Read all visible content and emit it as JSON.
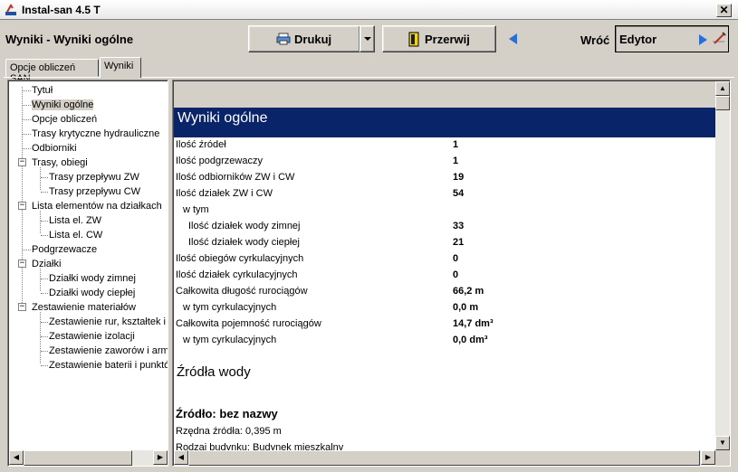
{
  "window": {
    "title": "Instal-san 4.5 T",
    "close": "✕"
  },
  "header": {
    "heading": "Wyniki - Wyniki ogólne",
    "print_label": "Drukuj",
    "break_label": "Przerwij",
    "back_label": "Wróć",
    "editor_label": "Edytor"
  },
  "tabs": [
    {
      "label": "Opcje obliczeń SAN"
    },
    {
      "label": "Wyniki"
    }
  ],
  "tree": {
    "items": [
      "Tytuł",
      "Wyniki ogólne",
      "Opcje obliczeń",
      "Trasy krytyczne hydrauliczne",
      "Odbiorniki",
      "Trasy, obiegi",
      "Trasy przepływu ZW",
      "Trasy przepływu CW",
      "Lista elementów na działkach",
      "Lista el. ZW",
      "Lista el. CW",
      "Podgrzewacze",
      "Działki",
      "Działki wody zimnej",
      "Działki wody ciepłej",
      "Zestawienie materiałów",
      "Zestawienie rur, kształtek i",
      "Zestawienie izolacji",
      "Zestawienie zaworów i armat",
      "Zestawienie baterii i punktów"
    ],
    "expander_minus": "−"
  },
  "content": {
    "banner": "Wyniki ogólne",
    "rows": [
      {
        "label": "Ilość źródeł",
        "value": "1"
      },
      {
        "label": "Ilość podgrzewaczy",
        "value": "1"
      },
      {
        "label": "Ilość odbiorników ZW i CW",
        "value": "19"
      },
      {
        "label": "Ilość działek ZW i CW",
        "value": "54"
      },
      {
        "label": "w tym",
        "value": ""
      },
      {
        "label": "Ilość działek wody zimnej",
        "value": "33"
      },
      {
        "label": "Ilość działek wody ciepłej",
        "value": "21"
      },
      {
        "label": "Ilość obiegów cyrkulacyjnych",
        "value": "0"
      },
      {
        "label": "Ilość działek cyrkulacyjnych",
        "value": "0"
      },
      {
        "label": "Całkowita długość rurociągów",
        "value": "66,2 m"
      },
      {
        "label": "w tym cyrkulacyjnych",
        "value": "0,0 m"
      },
      {
        "label": "Całkowita pojemność rurociągów",
        "value": "14,7 dm³"
      },
      {
        "label": "w tym cyrkulacyjnych",
        "value": "0,0 dm³"
      }
    ],
    "section_heading": "Źródła wody",
    "source_heading": "Źródło: bez nazwy",
    "source_lines": [
      "Rzędna źródła: 0,395 m",
      "Rodzaj budynku: Budynek mieszkalny"
    ]
  },
  "colors": {
    "banner": "#0a246a",
    "selection": "#d4d0c8",
    "face": "#d4d0c8"
  },
  "icons": [
    "app-icon",
    "printer-icon",
    "door-icon",
    "arrow-left-icon",
    "arrow-right-icon",
    "editor-icon"
  ]
}
